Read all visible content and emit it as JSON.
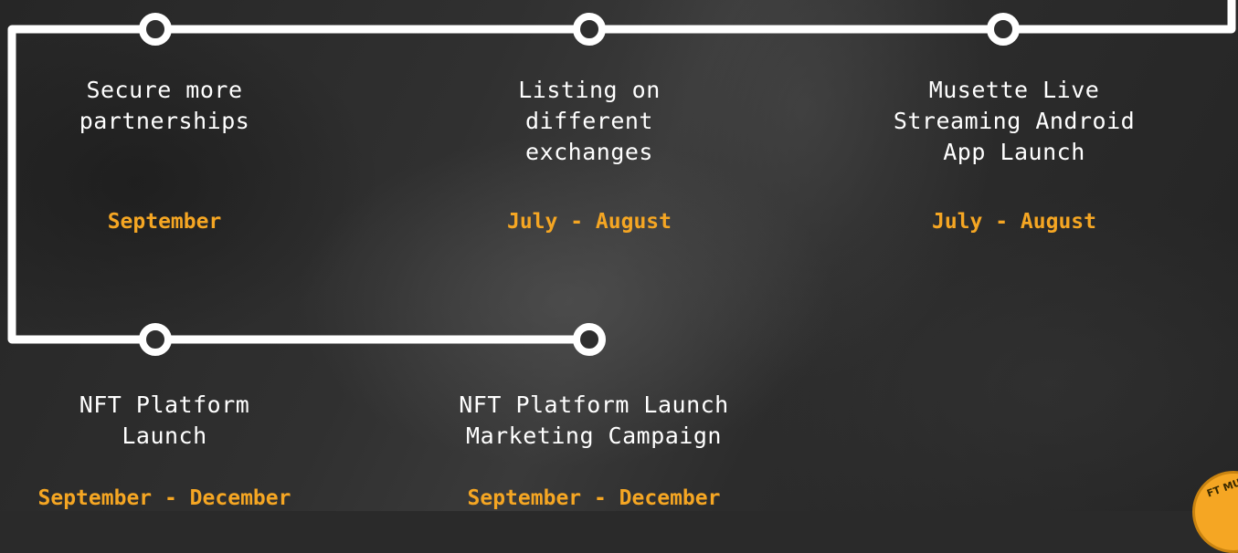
{
  "colors": {
    "line": "#ffffff",
    "date": "#f5a623",
    "title": "#ffffff"
  },
  "milestones": [
    {
      "title": "Secure more\npartnerships",
      "date": "September"
    },
    {
      "title": "Listing on\ndifferent\nexchanges",
      "date": "July - August"
    },
    {
      "title": "Musette Live\nStreaming Android\nApp Launch",
      "date": "July - August"
    },
    {
      "title": "NFT Platform\nLaunch",
      "date": "September - December"
    },
    {
      "title": "NFT Platform Launch\nMarketing Campaign",
      "date": "September - December"
    }
  ],
  "logo": {
    "text": "NFT MUSETTE",
    "visible_fragment": "FT MUS"
  }
}
